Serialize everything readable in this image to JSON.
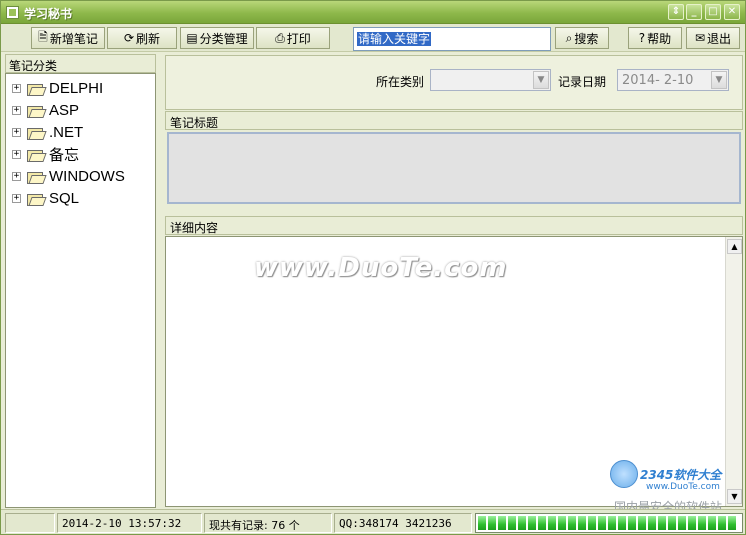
{
  "window": {
    "title": "学习秘书"
  },
  "titlebar_buttons": [
    "⇕",
    "_",
    "□",
    "✕"
  ],
  "toolbar": {
    "new_note": "新增笔记",
    "refresh": "刷新",
    "category_manage": "分类管理",
    "print": "打印",
    "search_placeholder": "请输入关键字",
    "search": "搜索",
    "help": "帮助",
    "exit": "退出"
  },
  "sidebar": {
    "header": "笔记分类",
    "items": [
      {
        "label": "DELPHI"
      },
      {
        "label": "ASP"
      },
      {
        "label": ".NET"
      },
      {
        "label": "备忘"
      },
      {
        "label": "WINDOWS"
      },
      {
        "label": "SQL"
      }
    ]
  },
  "filters": {
    "category_label": "所在类别",
    "category_value": "",
    "date_label": "记录日期",
    "date_value": "2014- 2-10"
  },
  "note_title": {
    "header": "笔记标题"
  },
  "note_content": {
    "header": "详细内容"
  },
  "watermark": "www.DuoTe.com",
  "brand": {
    "name": "2345软件大全",
    "url": "www.DuoTe.com",
    "slogan": "国内最安全的软件站"
  },
  "status": {
    "datetime": "2014-2-10 13:57:32",
    "records": "现共有记录: 76 个",
    "qq": "QQ:348174   3421236",
    "progress_fraction": 1.0
  },
  "colors": {
    "title_bar": "#8eb84b",
    "progress": "#2fbf2f",
    "selection": "#3169c6"
  }
}
